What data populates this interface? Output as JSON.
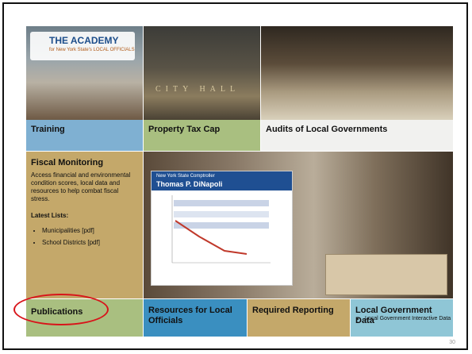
{
  "tiles": {
    "training": {
      "label": "Training"
    },
    "property_tax_cap": {
      "label": "Property Tax Cap"
    },
    "audits": {
      "label": "Audits of Local Governments"
    },
    "fiscal": {
      "title": "Fiscal Monitoring",
      "description": "Access financial and environmental condition scores, local data and resources to help combat fiscal stress.",
      "lists_heading": "Latest Lists:",
      "items": [
        "Municipalities [pdf]",
        "School Districts [pdf]"
      ]
    },
    "publications": {
      "label": "Publications"
    },
    "resources": {
      "label": "Resources for Local Officials"
    },
    "required": {
      "label": "Required Reporting"
    },
    "lgdata": {
      "label": "Local Government Data",
      "items": [
        "Local Government Interactive Data"
      ]
    }
  },
  "photos": {
    "academy_logo": "THE ACADEMY",
    "academy_sub": "for New York State's LOCAL OFFICIALS",
    "city_hall": "CITY HALL",
    "comptroller_line1": "New York State Comptroller",
    "comptroller_line2": "Thomas P. DiNapoli"
  },
  "slide_number": "30",
  "colors": {
    "training": "#7fb0d2",
    "green": "#a9bf80",
    "tan": "#c4a86a",
    "blue": "#3a8fc0",
    "lightblue": "#8fc6d6",
    "highlight": "#d8141a"
  }
}
